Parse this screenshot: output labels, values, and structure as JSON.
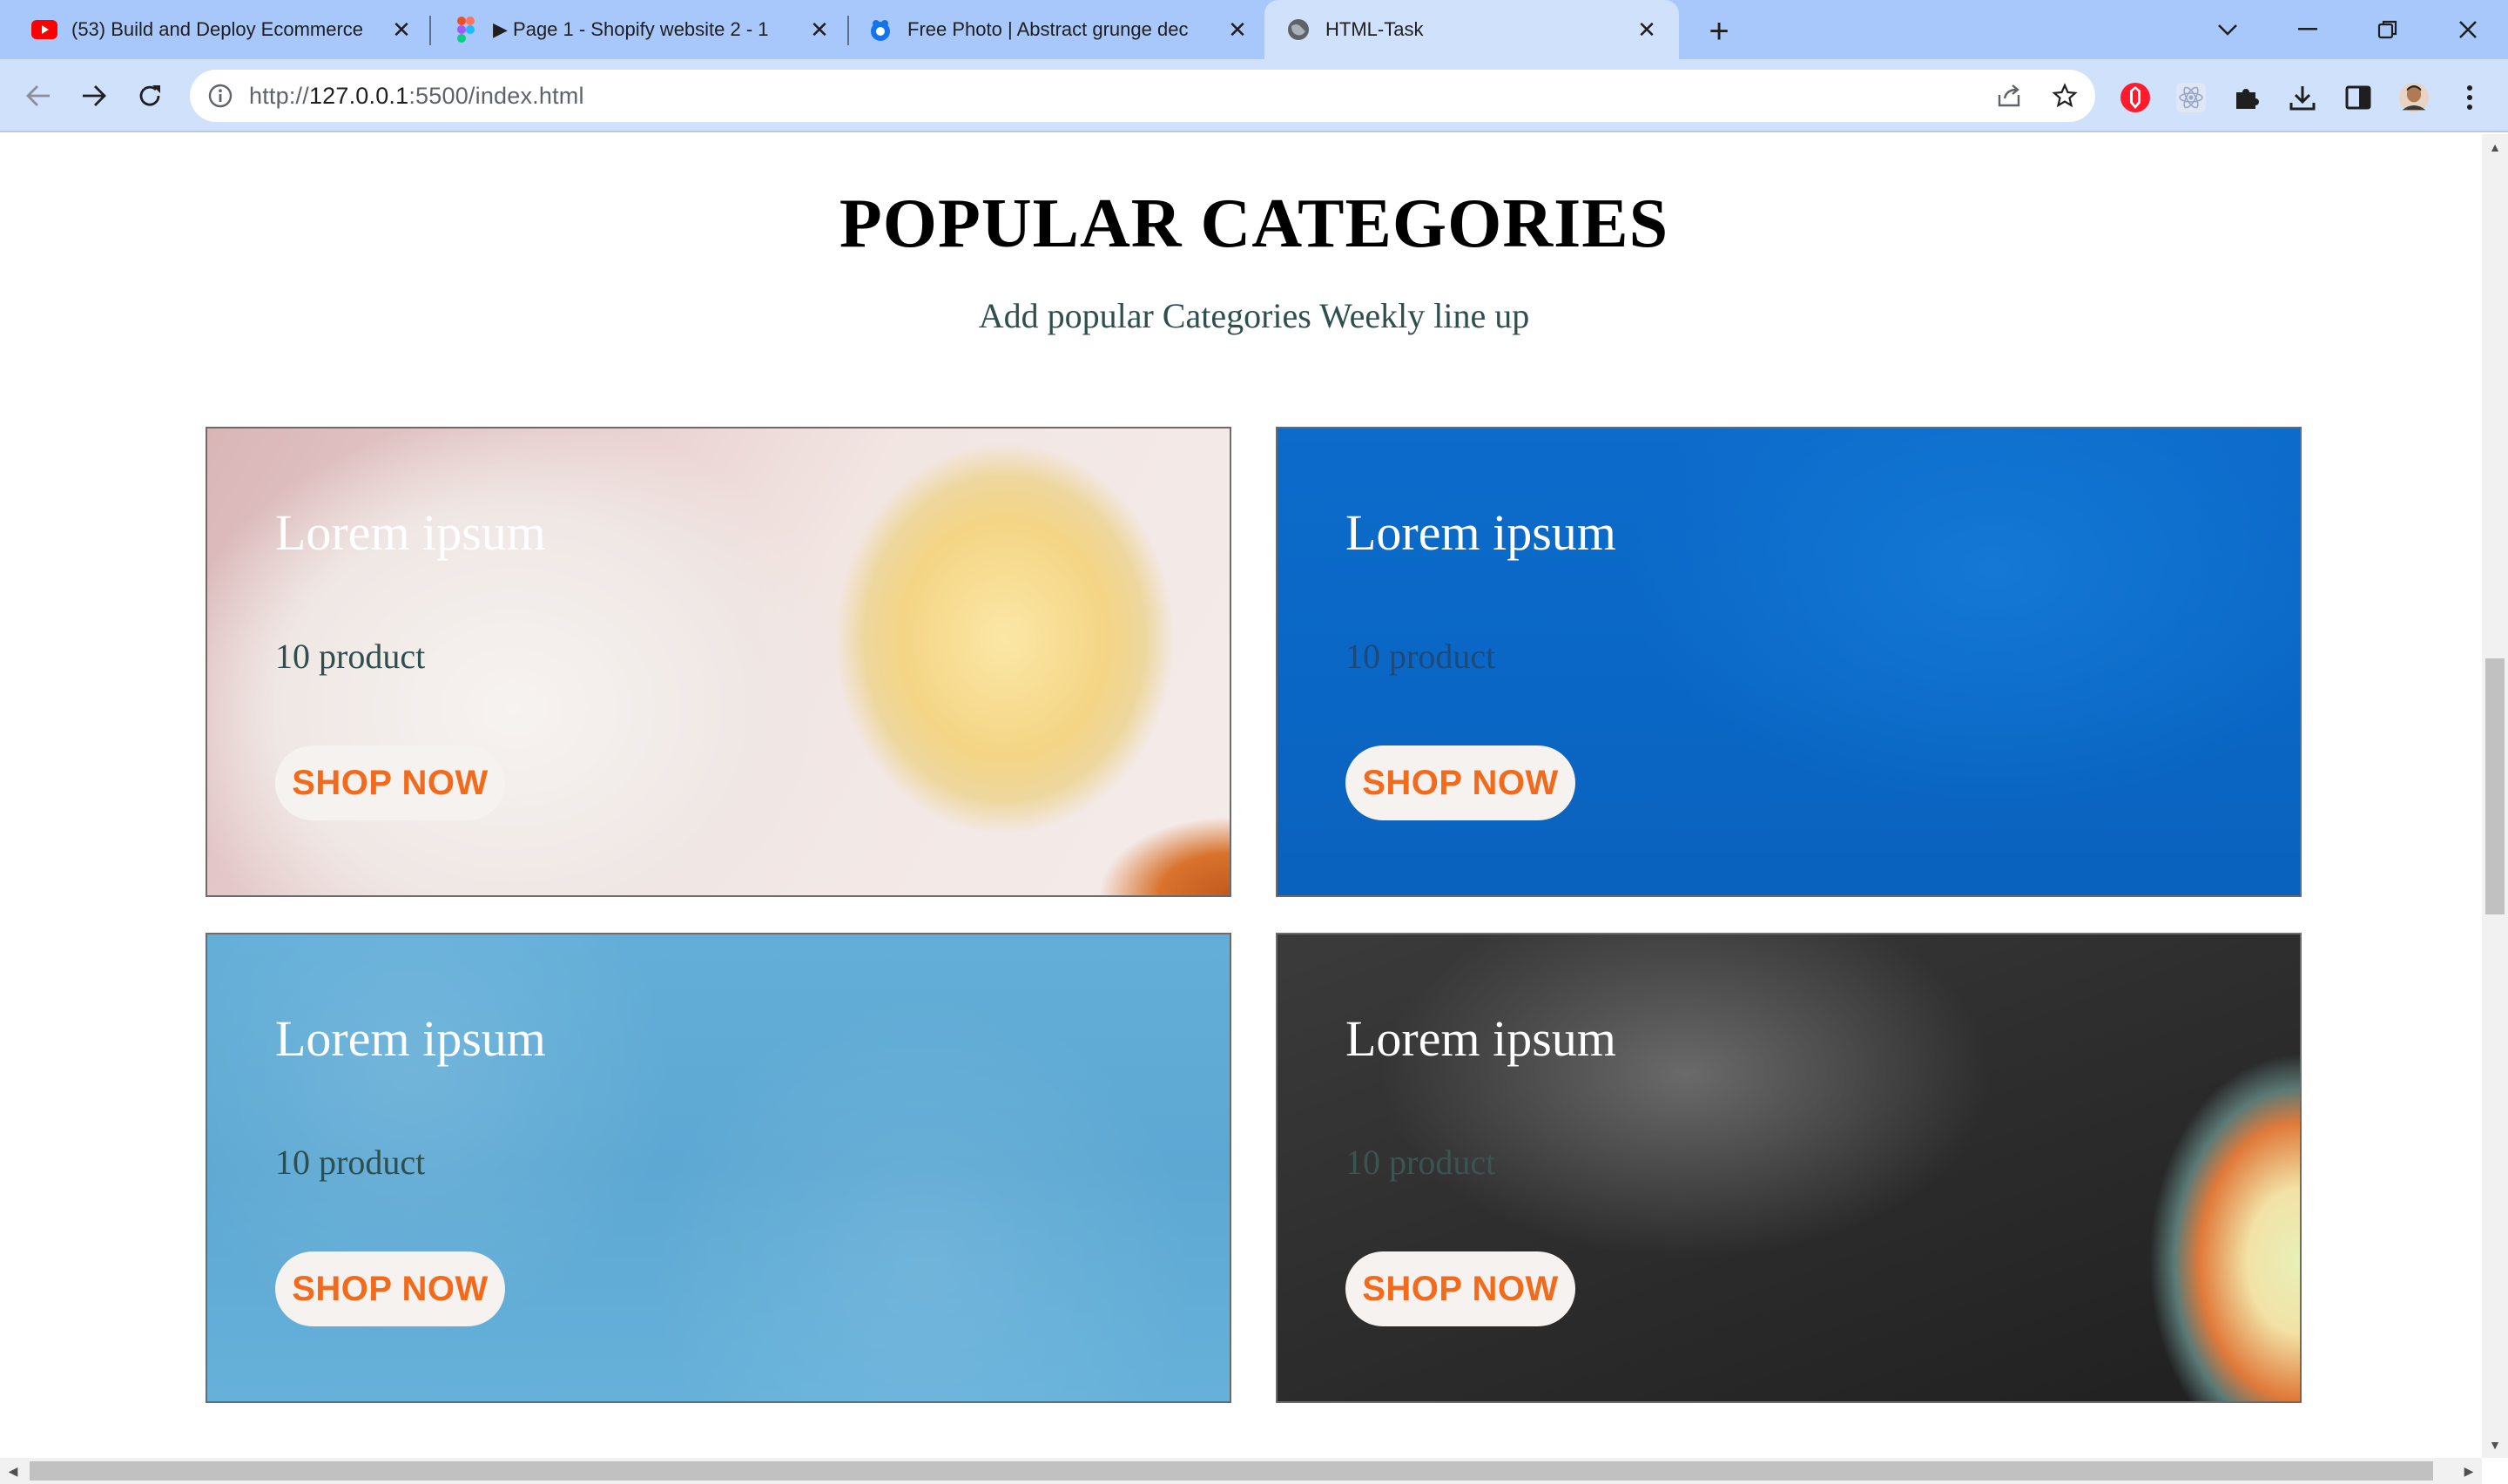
{
  "browser": {
    "tabs": [
      {
        "title": "(53) Build and Deploy Ecommerce",
        "favicon": "youtube-icon",
        "close": "✕"
      },
      {
        "title": "▶ Page 1 - Shopify website 2 - 1",
        "favicon": "figma-icon",
        "close": "✕"
      },
      {
        "title": "Free Photo | Abstract grunge dec",
        "favicon": "freepik-icon",
        "close": "✕"
      },
      {
        "title": "HTML-Task",
        "favicon": "globe-icon",
        "close": "✕"
      }
    ],
    "new_tab": "+",
    "url_host": "127.0.0.1",
    "url_prefix": "http://",
    "url_suffix": ":5500/index.html",
    "accent": "#a8c7fa"
  },
  "page": {
    "title": "POPULAR CATEGORIES",
    "subtitle": "Add popular Categories Weekly line up",
    "cards": [
      {
        "title": "Lorem ipsum",
        "count": "10 product",
        "button": "SHOP NOW",
        "background": "rice-plate"
      },
      {
        "title": "Lorem ipsum",
        "count": "10 product",
        "button": "SHOP NOW",
        "background": "blue-texture"
      },
      {
        "title": "Lorem ipsum",
        "count": "10 product",
        "button": "SHOP NOW",
        "background": "light-blue-texture"
      },
      {
        "title": "Lorem ipsum",
        "count": "10 product",
        "button": "SHOP NOW",
        "background": "dark-stone-food"
      }
    ],
    "button_color": "#f26a1b"
  }
}
